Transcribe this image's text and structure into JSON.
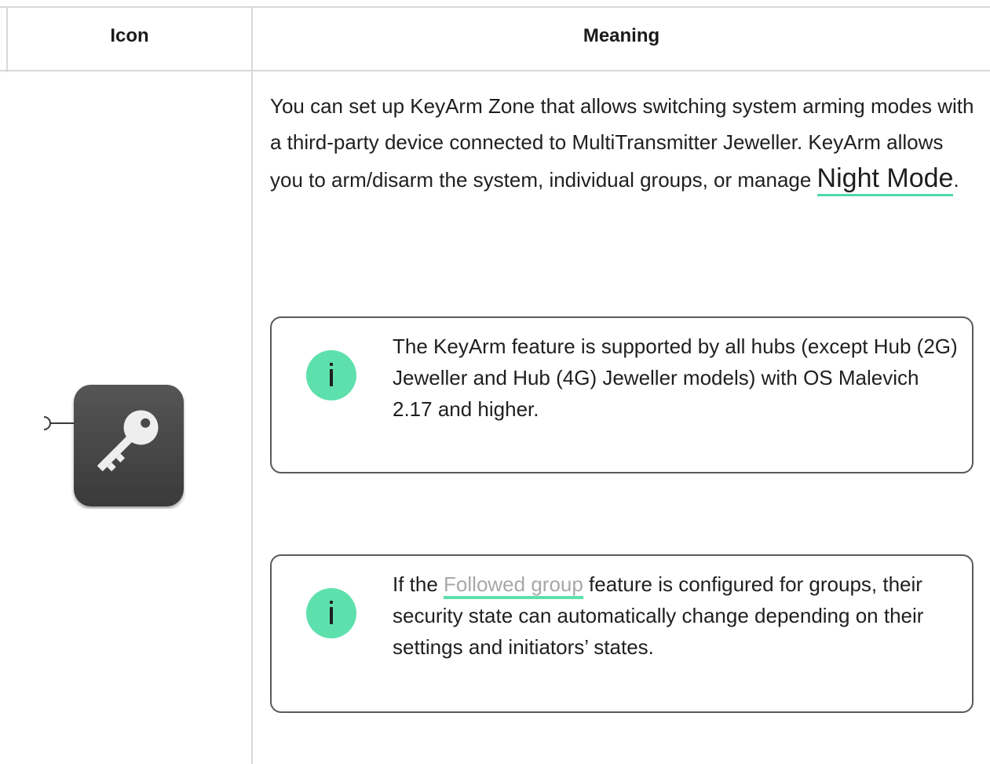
{
  "table": {
    "headers": {
      "icon": "Icon",
      "meaning": "Meaning"
    }
  },
  "row": {
    "icon_name": "keyarm-zone-key-icon",
    "description_before": "You can set up KeyArm Zone that allows switching system arming modes with a third-party device connected to MultiTransmitter Jeweller. KeyArm allows you to arm/disarm the system, individual groups, or manage ",
    "night_mode_link": "Night Mode",
    "description_after": ".",
    "notes": [
      {
        "icon": "info-icon",
        "text": "The KeyArm feature is supported by all hubs (except Hub (2G) Jeweller and Hub (4G) Jeweller models) with OS Malevich 2.17 and higher."
      },
      {
        "icon": "info-icon",
        "text_before": "If the ",
        "link": "Followed group",
        "text_after": " feature is configured for groups, their security state can automatically change depending on their settings and initiators’ states."
      }
    ]
  },
  "colors": {
    "accent": "#5ee0ad",
    "border": "#d9d9d9",
    "note_border": "#5a5a5a",
    "icon_tile": "#4a4a4a"
  }
}
